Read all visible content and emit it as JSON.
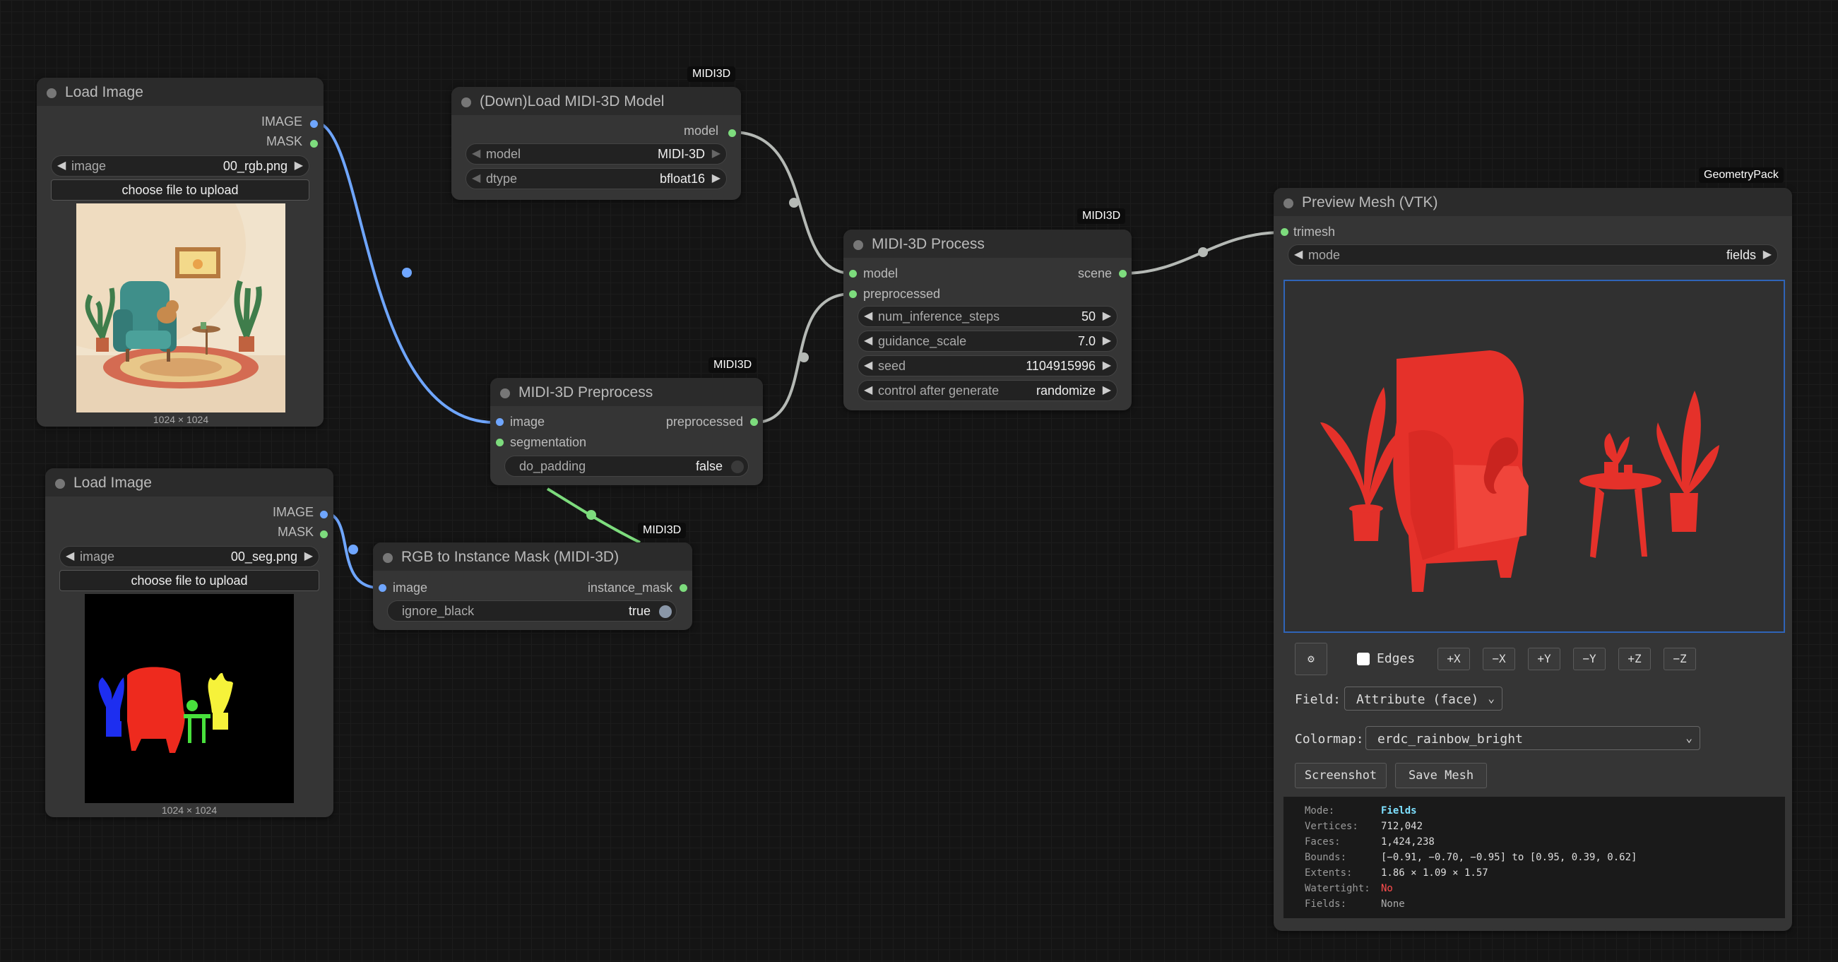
{
  "colors": {
    "image_link": "#6fa6ff",
    "mask_link": "#7ddc7d",
    "model_link": "#b5b9b5",
    "title_dot": "#777777",
    "viewer_border": "#2f64b8",
    "mesh_red": "#e5312a",
    "watertight_no": "#ff4d4d",
    "mode_fields": "#7ee0ff"
  },
  "load_image_1": {
    "title": "Load Image",
    "outputs": [
      "IMAGE",
      "MASK"
    ],
    "widget_label": "image",
    "widget_value": "00_rgb.png",
    "upload_label": "choose file to upload",
    "size_caption": "1024 × 1024"
  },
  "load_image_2": {
    "title": "Load Image",
    "outputs": [
      "IMAGE",
      "MASK"
    ],
    "widget_label": "image",
    "widget_value": "00_seg.png",
    "upload_label": "choose file to upload",
    "size_caption": "1024 × 1024"
  },
  "load_model": {
    "badge": "MIDI3D",
    "title": "(Down)Load MIDI-3D Model",
    "output": "model",
    "widgets": [
      {
        "label": "model",
        "value": "MIDI-3D"
      },
      {
        "label": "dtype",
        "value": "bfloat16"
      }
    ]
  },
  "preprocess": {
    "badge": "MIDI3D",
    "title": "MIDI-3D Preprocess",
    "inputs": [
      "image",
      "segmentation"
    ],
    "output": "preprocessed",
    "toggle_label": "do_padding",
    "toggle_value": "false"
  },
  "rgb_mask": {
    "badge": "MIDI3D",
    "title": "RGB to Instance Mask (MIDI-3D)",
    "input": "image",
    "output": "instance_mask",
    "toggle_label": "ignore_black",
    "toggle_value": "true"
  },
  "process": {
    "badge": "MIDI3D",
    "title": "MIDI-3D Process",
    "inputs": [
      "model",
      "preprocessed"
    ],
    "output": "scene",
    "widgets": [
      {
        "label": "num_inference_steps",
        "value": "50"
      },
      {
        "label": "guidance_scale",
        "value": "7.0"
      },
      {
        "label": "seed",
        "value": "1104915996"
      },
      {
        "label": "control after generate",
        "value": "randomize"
      }
    ]
  },
  "preview": {
    "badge": "GeometryPack",
    "title": "Preview Mesh (VTK)",
    "input": "trimesh",
    "mode_label": "mode",
    "mode_value": "fields",
    "settings_icon": "gear-icon",
    "edges_label": "Edges",
    "axis_buttons": [
      "+X",
      "−X",
      "+Y",
      "−Y",
      "+Z",
      "−Z"
    ],
    "field_label": "Field:",
    "field_value": "Attribute (face)",
    "colormap_label": "Colormap:",
    "colormap_value": "erdc_rainbow_bright",
    "screenshot_label": "Screenshot",
    "save_label": "Save Mesh",
    "info": [
      {
        "key": "Mode:",
        "value": "Fields"
      },
      {
        "key": "Vertices:",
        "value": "712,042"
      },
      {
        "key": "Faces:",
        "value": "1,424,238"
      },
      {
        "key": "Bounds:",
        "value": "[−0.91, −0.70, −0.95] to [0.95, 0.39, 0.62]"
      },
      {
        "key": "Extents:",
        "value": "1.86 × 1.09 × 1.57"
      },
      {
        "key": "Watertight:",
        "value": "No"
      },
      {
        "key": "Fields:",
        "value": "None"
      }
    ]
  }
}
